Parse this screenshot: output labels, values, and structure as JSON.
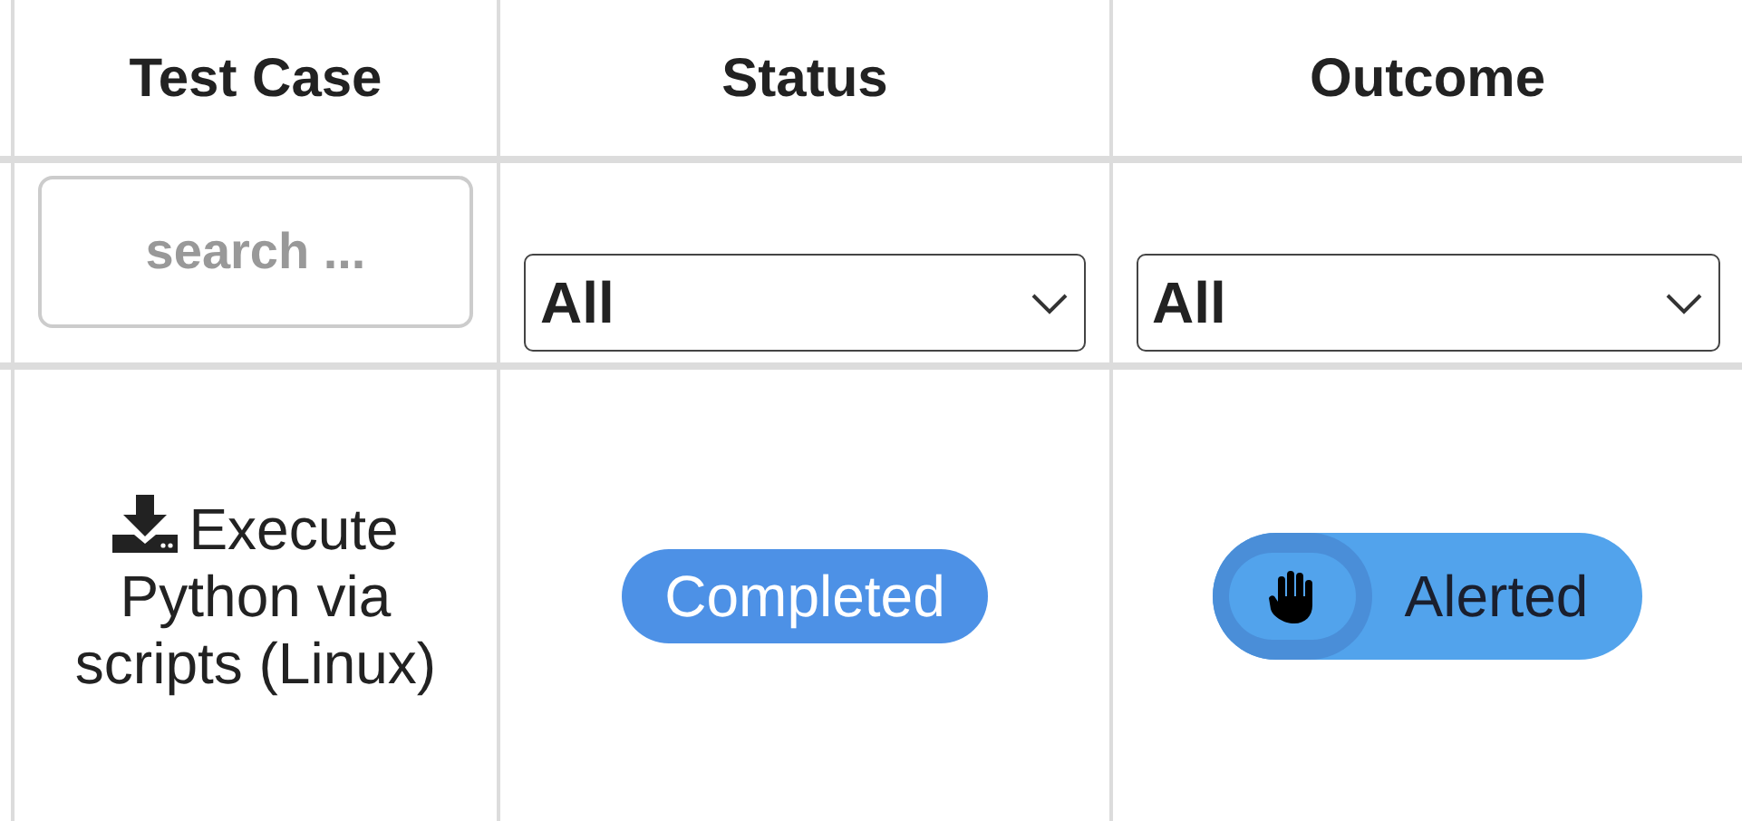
{
  "table": {
    "columns": [
      "Test Case",
      "Status",
      "Outcome"
    ],
    "filters": [
      {
        "kind": "search",
        "placeholder": "search ..."
      },
      {
        "kind": "select",
        "value": "All"
      },
      {
        "kind": "select",
        "value": "All"
      }
    ],
    "rows": [
      {
        "test_case": "Execute Python via scripts (Linux)",
        "status": "Completed",
        "outcome": "Alerted"
      }
    ]
  }
}
